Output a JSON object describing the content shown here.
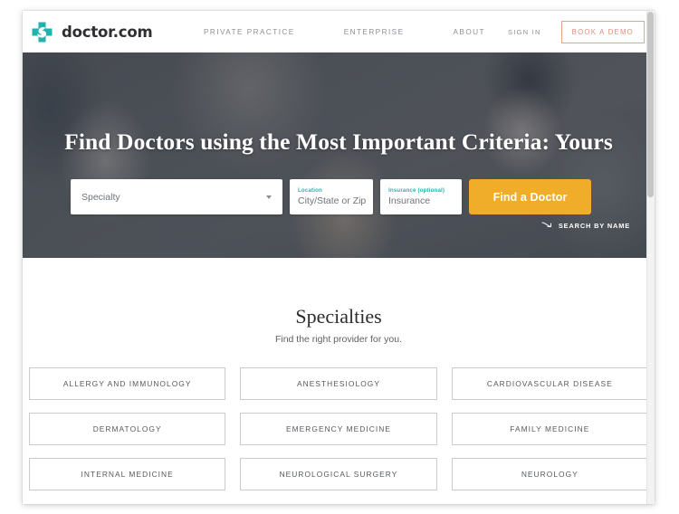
{
  "header": {
    "brand_name": "doctor.com",
    "logo_icon": "medical-cross-swirl-icon",
    "nav": [
      {
        "label": "PRIVATE PRACTICE"
      },
      {
        "label": "ENTERPRISE"
      },
      {
        "label": "ABOUT"
      }
    ],
    "sign_in_label": "SIGN IN",
    "book_demo_label": "BOOK A DEMO",
    "book_demo_color": "#e08f79"
  },
  "hero": {
    "headline": "Find Doctors using the Most Important Criteria: Yours",
    "search": {
      "specialty": {
        "value": "Specialty",
        "caret_icon": "chevron-down-icon"
      },
      "location": {
        "label": "Location",
        "placeholder": "City/State or Zip",
        "value": ""
      },
      "insurance": {
        "label": "Insurance (optional)",
        "placeholder": "Insurance",
        "value": ""
      },
      "submit_label": "Find a Doctor",
      "submit_color": "#f0ad29",
      "label_color": "#25b5ae"
    },
    "search_by_name": {
      "label": "SEARCH BY NAME",
      "icon": "arrow-right-curve-icon"
    }
  },
  "specialties": {
    "title": "Specialties",
    "subtitle": "Find the right provider for you.",
    "cards": [
      {
        "label": "ALLERGY AND IMMUNOLOGY"
      },
      {
        "label": "ANESTHESIOLOGY"
      },
      {
        "label": "CARDIOVASCULAR DISEASE"
      },
      {
        "label": "DERMATOLOGY"
      },
      {
        "label": "EMERGENCY MEDICINE"
      },
      {
        "label": "FAMILY MEDICINE"
      },
      {
        "label": "INTERNAL MEDICINE"
      },
      {
        "label": "NEUROLOGICAL SURGERY"
      },
      {
        "label": "NEUROLOGY"
      }
    ]
  }
}
